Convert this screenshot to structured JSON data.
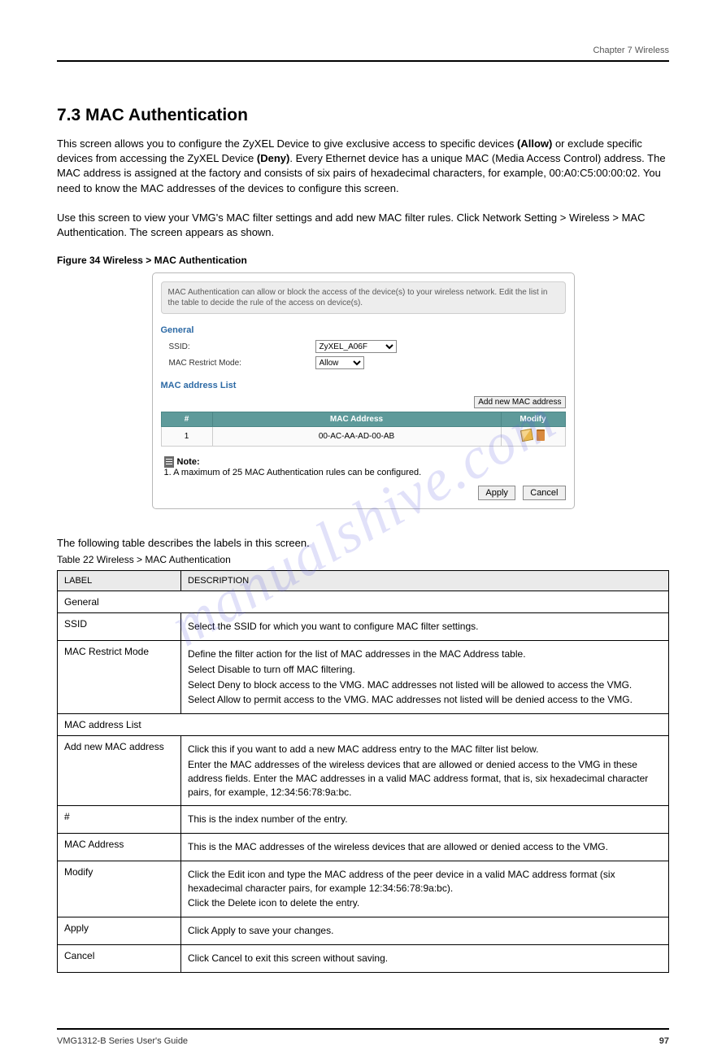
{
  "header": {
    "chapter": "Chapter 7 Wireless"
  },
  "section": {
    "number": "7.3  MAC Authentication",
    "desc_prefix": "This screen allows you to configure the ZyXEL Device to give exclusive access to specific devices ",
    "desc_allow": "(Allow)",
    "desc_mid": " or exclude specific devices from accessing the ZyXEL Device ",
    "desc_deny": "(Deny)",
    "desc_suffix1": ". Every Ethernet device has a unique MAC (Media Access Control) address. The MAC address is assigned at the factory and consists of six pairs of hexadecimal characters, for example, 00:A0:C5:00:00:02. You need to know the MAC addresses of the devices to configure this screen.",
    "desc2": "Use this screen to view your VMG's MAC filter settings and add new MAC filter rules. Click Network Setting > Wireless > MAC Authentication. The screen appears as shown."
  },
  "figure": {
    "label": "Figure 34   Wireless > MAC Authentication"
  },
  "config": {
    "info_text": "MAC Authentication can allow or block the access of the device(s) to your wireless network. Edit the list in the table to decide the rule of the access on device(s).",
    "general_title": "General",
    "ssid_label": "SSID:",
    "ssid_value": "ZyXEL_A06F",
    "mode_label": "MAC Restrict Mode:",
    "mode_value": "Allow",
    "list_title": "MAC address List",
    "add_btn": "Add new MAC address",
    "col_num": "#",
    "col_mac": "MAC Address",
    "col_modify": "Modify",
    "rows": [
      {
        "n": "1",
        "mac": "00-AC-AA-AD-00-AB"
      }
    ],
    "note_title": "Note:",
    "note_text": "1. A maximum of 25 MAC Authentication rules can be configured.",
    "apply": "Apply",
    "cancel": "Cancel"
  },
  "fields": {
    "intro": "The following table describes the labels in this screen.",
    "caption": "Table 22   Wireless > MAC Authentication",
    "header_label": "LABEL",
    "header_desc": "DESCRIPTION",
    "rows": [
      {
        "label": "General",
        "desc": "",
        "section": true
      },
      {
        "label": "SSID",
        "desc": "Select the SSID for which you want to configure MAC filter settings."
      },
      {
        "label": "MAC Restrict Mode",
        "desc": "Define the filter action for the list of MAC addresses in the MAC Address table.\nSelect Disable to turn off MAC filtering.\nSelect Deny to block access to the VMG. MAC addresses not listed will be allowed to access the VMG.\nSelect Allow to permit access to the VMG. MAC addresses not listed will be denied access to the VMG."
      },
      {
        "label": "MAC address List",
        "desc": "",
        "section": true
      },
      {
        "label": "Add new MAC address",
        "desc": "Click this if you want to add a new MAC address entry to the MAC filter list below.\nEnter the MAC addresses of the wireless devices that are allowed or denied access to the VMG in these address fields. Enter the MAC addresses in a valid MAC address format, that is, six hexadecimal character pairs, for example, 12:34:56:78:9a:bc."
      },
      {
        "label": "#",
        "desc": "This is the index number of the entry."
      },
      {
        "label": "MAC Address",
        "desc": "This is the MAC addresses of the wireless devices that are allowed or denied access to the VMG."
      },
      {
        "label": "Modify",
        "desc": "Click the Edit icon and type the MAC address of the peer device in a valid MAC address format (six hexadecimal character pairs, for example 12:34:56:78:9a:bc).\nClick the Delete icon to delete the entry."
      },
      {
        "label": "Apply",
        "desc": "Click Apply to save your changes."
      },
      {
        "label": "Cancel",
        "desc": "Click Cancel to exit this screen without saving."
      }
    ]
  },
  "footer": {
    "left": "VMG1312-B Series User's Guide",
    "right": "97"
  },
  "watermark": "manualshive.com"
}
